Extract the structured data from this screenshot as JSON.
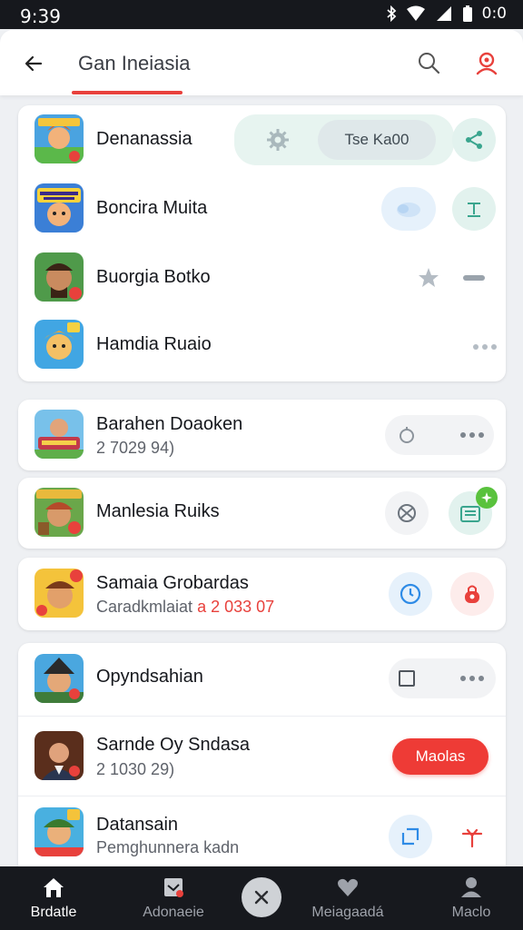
{
  "status_bar": {
    "time": "9:39",
    "battery": "0:0"
  },
  "header": {
    "title": "Gan Ineiasia"
  },
  "groups": [
    {
      "rows": [
        {
          "title": "Denanassia",
          "chip": "Tse Ka00"
        },
        {
          "title": "Boncira Muita"
        },
        {
          "title": "Buorgia Botko"
        },
        {
          "title": "Hamdia Ruaio"
        }
      ]
    },
    {
      "rows": [
        {
          "title": "Barahen Doaoken",
          "subtitle": "2 7029 94)"
        }
      ]
    },
    {
      "rows": [
        {
          "title": "Manlesia Ruiks"
        }
      ]
    },
    {
      "rows": [
        {
          "title": "Samaia Grobardas",
          "subtitle": "Caradkmlaiat",
          "subtitle_accent": "a 2 033 07"
        }
      ]
    },
    {
      "rows": [
        {
          "title": "Opyndsahian"
        },
        {
          "title": "Sarnde Oy Sndasa",
          "subtitle": "2 1030 29)",
          "button": "Maolas"
        },
        {
          "title": "Datansain",
          "subtitle": "Pemghunnera kadn"
        }
      ]
    }
  ],
  "bottom_nav": [
    {
      "label": "Brdatle",
      "icon": "home-icon",
      "active": true
    },
    {
      "label": "Adonaeie",
      "icon": "inbox-icon",
      "active": false
    },
    {
      "label": "Meiagaadá",
      "icon": "heart-icon",
      "active": false
    },
    {
      "label": "Maclo",
      "icon": "person-icon",
      "active": false
    }
  ],
  "colors": {
    "accent": "#e8413c",
    "teal": "#3aa58e",
    "blue": "#2e8be6",
    "nav_bg": "#17191e"
  }
}
